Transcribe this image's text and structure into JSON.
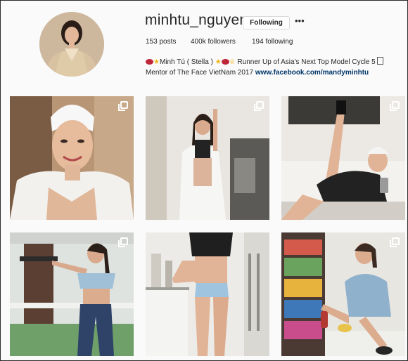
{
  "profile": {
    "username": "minhtu_nguyen",
    "follow_button": "Following",
    "more_label": "•••",
    "stats": {
      "posts": "153 posts",
      "followers": "400k followers",
      "following": "194 following"
    },
    "bio": {
      "name": "Minh Tú ( Stella )",
      "line1_rest": "Runner Up of Asia's Next Top Model Cycle 5",
      "line2_start": "Mentor",
      "line2": "of The Face VietNam 2017",
      "link": "www.facebook.com/mandyminhtu"
    }
  },
  "colors": {
    "background": "#fafafa",
    "button_border": "#dbdbdb",
    "link": "#003569",
    "text": "#262626"
  },
  "grid": {
    "posts": [
      {
        "name": "post-1",
        "multi": true,
        "icon": "multiple-posts-icon"
      },
      {
        "name": "post-2",
        "multi": true,
        "icon": "multiple-posts-icon"
      },
      {
        "name": "post-3",
        "multi": true,
        "icon": "multiple-posts-icon"
      },
      {
        "name": "post-4",
        "multi": true,
        "icon": "multiple-posts-icon"
      },
      {
        "name": "post-5",
        "multi": true,
        "icon": "multiple-posts-icon"
      },
      {
        "name": "post-6",
        "multi": true,
        "icon": "multiple-posts-icon"
      }
    ]
  }
}
